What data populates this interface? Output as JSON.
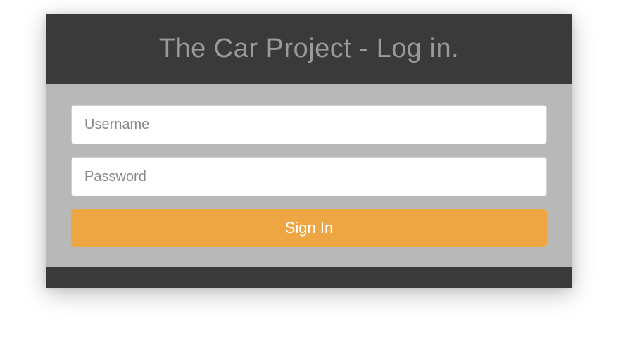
{
  "header": {
    "title": "The Car Project - Log in."
  },
  "form": {
    "username": {
      "placeholder": "Username",
      "value": ""
    },
    "password": {
      "placeholder": "Password",
      "value": ""
    },
    "submit_label": "Sign In"
  },
  "colors": {
    "header_bg": "#3a3a3a",
    "body_bg": "#b8b8b8",
    "accent": "#eea642"
  }
}
